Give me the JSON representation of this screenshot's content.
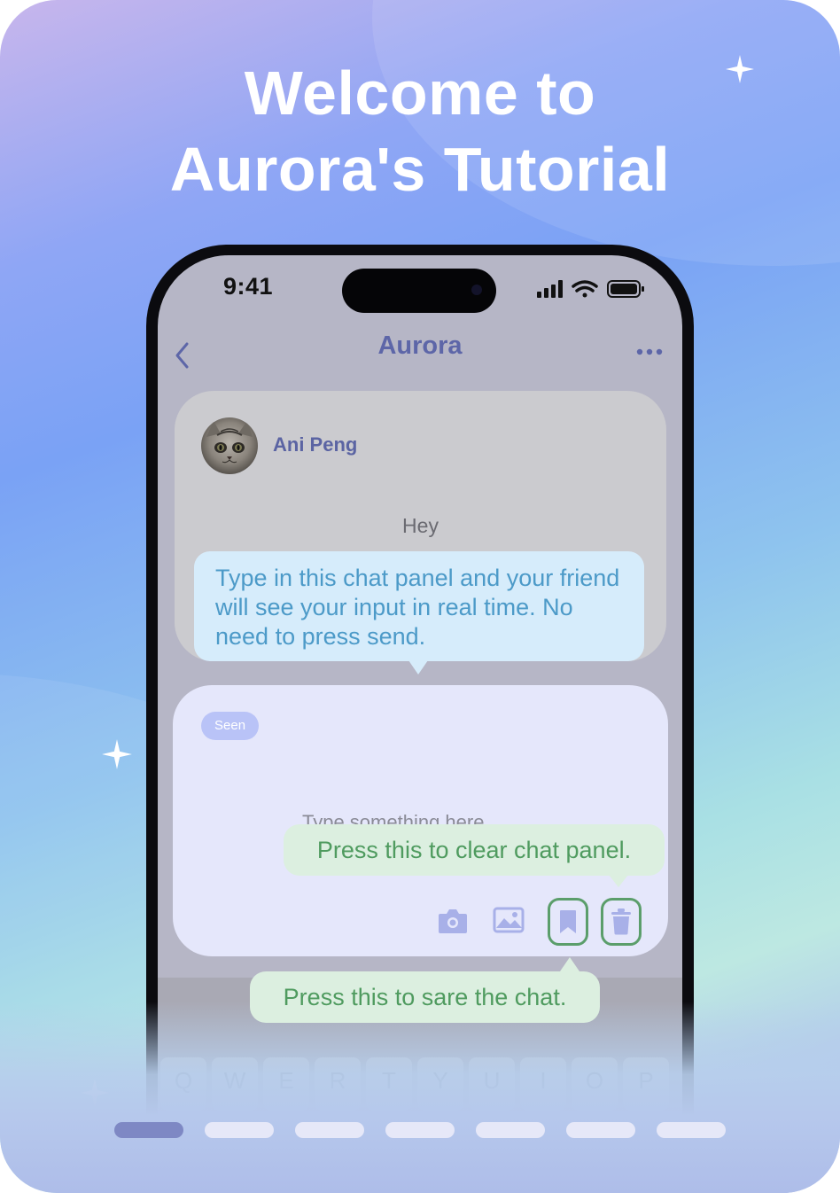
{
  "headline": {
    "line1": "Welcome to",
    "line2": "Aurora's Tutorial"
  },
  "phone": {
    "status_time": "9:41",
    "nav_title": "Aurora",
    "icons": {
      "back": "chevron-left-icon",
      "more": "more-dots-icon",
      "signal": "cellular-signal-icon",
      "wifi": "wifi-icon",
      "battery": "battery-icon"
    },
    "friend_panel": {
      "friend_name": "Ani Peng",
      "message": "Hey"
    },
    "my_panel": {
      "seen_label": "Seen",
      "placeholder": "Type something here",
      "tools": [
        "camera-icon",
        "image-icon",
        "bookmark-icon",
        "trash-icon"
      ]
    },
    "keyboard_row": [
      "Q",
      "W",
      "E",
      "R",
      "T",
      "Y",
      "U",
      "I",
      "O",
      "P"
    ]
  },
  "tooltips": {
    "chat_panel": "Type in this chat panel and your friend will see your input in real time. No need to press send.",
    "clear_panel": "Press this to clear chat panel.",
    "save_chat": "Press this to sare the chat."
  },
  "pager": {
    "total": 7,
    "active_index": 0
  },
  "colors": {
    "accent_purple": "#5d66a8",
    "tooltip_blue_text": "#4c9ac8",
    "tooltip_green_text": "#4f9b5f",
    "outline_green": "#5b9e6b",
    "pager_active": "#7e88c4",
    "pager_inactive": "#e6e8f8"
  }
}
